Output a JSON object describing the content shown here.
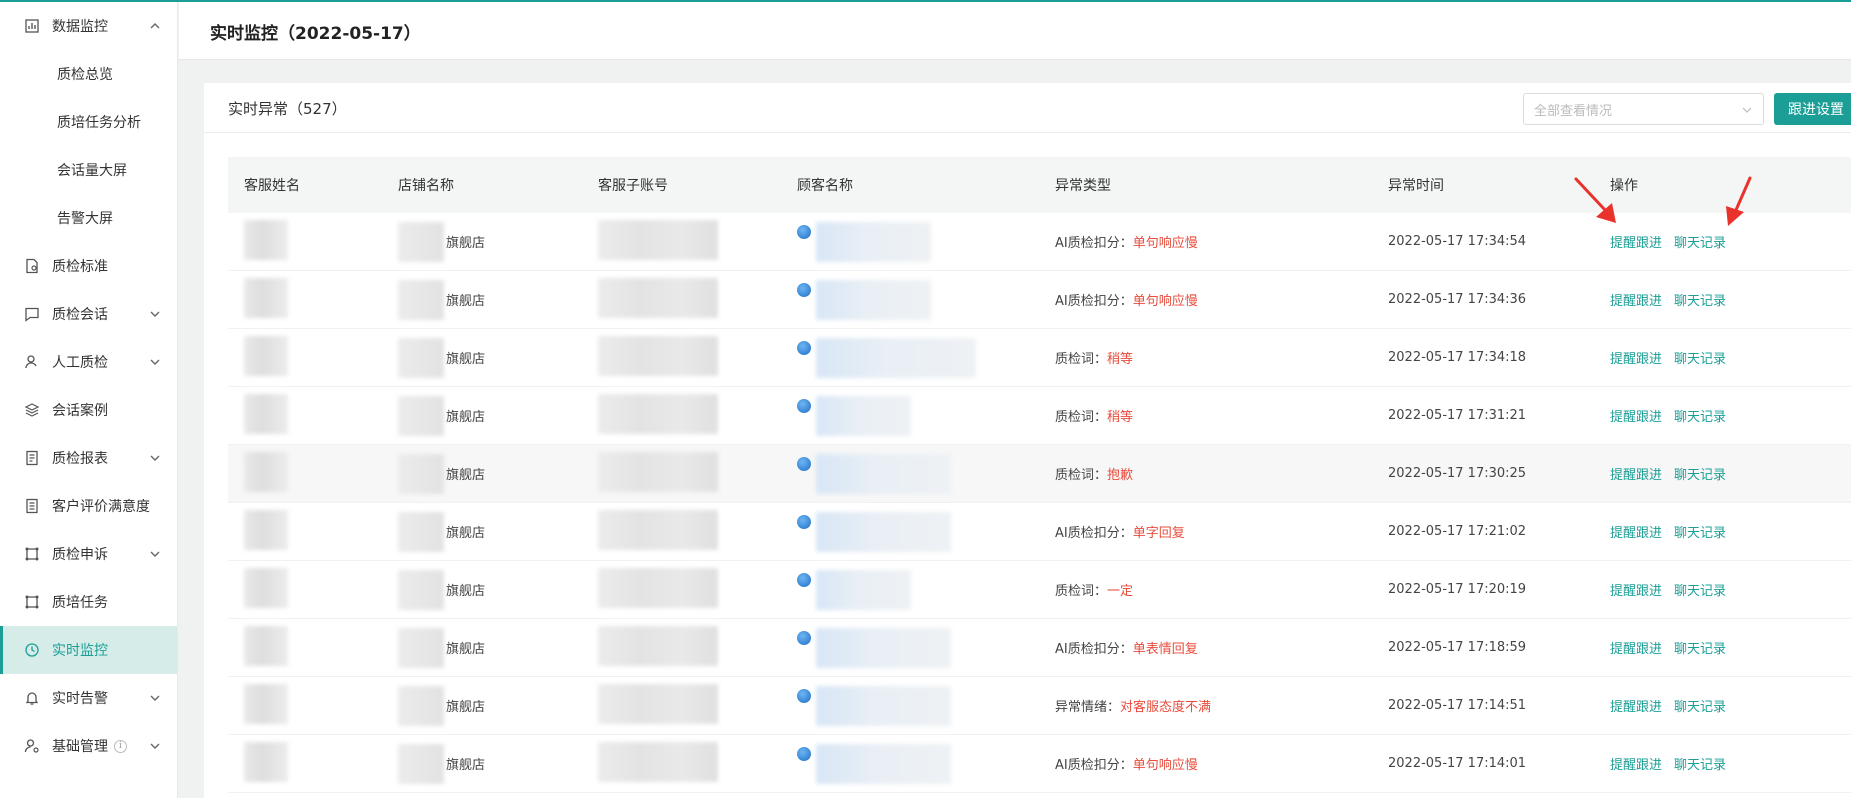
{
  "sidebar": {
    "items": [
      {
        "label": "数据监控",
        "icon": "bar-chart-icon",
        "expanded": true,
        "children": [
          "质检总览",
          "质培任务分析",
          "会话量大屏",
          "告警大屏"
        ]
      },
      {
        "label": "质检标准",
        "icon": "document-icon"
      },
      {
        "label": "质检会话",
        "icon": "chat-icon",
        "chevron": true
      },
      {
        "label": "人工质检",
        "icon": "user-icon",
        "chevron": true
      },
      {
        "label": "会话案例",
        "icon": "layers-icon"
      },
      {
        "label": "质检报表",
        "icon": "report-icon",
        "chevron": true
      },
      {
        "label": "客户评价满意度",
        "icon": "list-icon"
      },
      {
        "label": "质检申诉",
        "icon": "appeal-icon",
        "chevron": true
      },
      {
        "label": "质培任务",
        "icon": "task-icon"
      },
      {
        "label": "实时监控",
        "icon": "clock-icon",
        "active": true
      },
      {
        "label": "实时告警",
        "icon": "bell-icon",
        "chevron": true
      },
      {
        "label": "基础管理",
        "icon": "user-settings-icon",
        "chevron": true,
        "info": "i"
      }
    ]
  },
  "header": {
    "title": "实时监控（2022-05-17）"
  },
  "panel": {
    "title": "实时异常（527）",
    "filter_placeholder": "全部查看情况",
    "follow_button": "跟进设置"
  },
  "table": {
    "columns": [
      "客服姓名",
      "店铺名称",
      "客服子账号",
      "顾客名称",
      "异常类型",
      "异常时间",
      "操作"
    ],
    "shop_suffix": "旗舰店",
    "actions": {
      "remind": "提醒跟进",
      "chat": "聊天记录"
    },
    "rows": [
      {
        "type_prefix": "AI质检扣分：",
        "type_value": "单句响应慢",
        "time": "2022-05-17 17:34:54"
      },
      {
        "type_prefix": "AI质检扣分：",
        "type_value": "单句响应慢",
        "time": "2022-05-17 17:34:36"
      },
      {
        "type_prefix": "质检词：",
        "type_value": "稍等",
        "time": "2022-05-17 17:34:18"
      },
      {
        "type_prefix": "质检词：",
        "type_value": "稍等",
        "time": "2022-05-17 17:31:21"
      },
      {
        "type_prefix": "质检词：",
        "type_value": "抱歉",
        "time": "2022-05-17 17:30:25"
      },
      {
        "type_prefix": "AI质检扣分：",
        "type_value": "单字回复",
        "time": "2022-05-17 17:21:02"
      },
      {
        "type_prefix": "质检词：",
        "type_value": "一定",
        "time": "2022-05-17 17:20:19"
      },
      {
        "type_prefix": "AI质检扣分：",
        "type_value": "单表情回复",
        "time": "2022-05-17 17:18:59"
      },
      {
        "type_prefix": "异常情绪：",
        "type_value": "对客服态度不满",
        "time": "2022-05-17 17:14:51"
      },
      {
        "type_prefix": "AI质检扣分：",
        "type_value": "单句响应慢",
        "time": "2022-05-17 17:14:01"
      }
    ]
  },
  "colors": {
    "accent": "#1a9e96",
    "danger": "#e84c3d",
    "annotation": "#e8322b"
  }
}
